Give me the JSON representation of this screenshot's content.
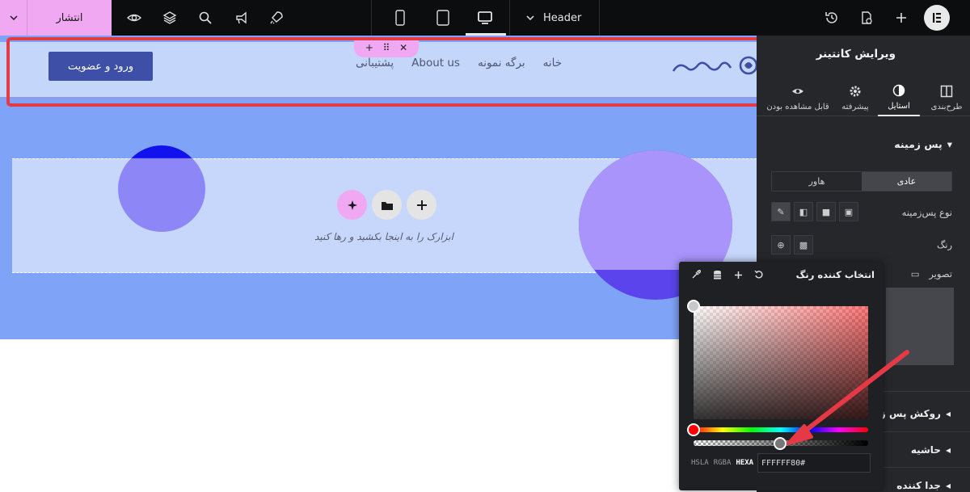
{
  "topbar": {
    "publish_label": "انتشار",
    "document_name": "Header",
    "icons": [
      "chevron-down-icon",
      "eye-icon",
      "layers-icon",
      "search-icon",
      "megaphone-icon",
      "rocket-icon",
      "mobile-icon",
      "tablet-icon",
      "desktop-icon",
      "history-icon",
      "page-settings-icon",
      "plus-icon",
      "elementor-logo"
    ]
  },
  "canvas": {
    "header": {
      "login_button": "ورود و عضویت",
      "nav": [
        "خانه",
        "برگه نمونه",
        "About us",
        "پشتیبانی"
      ],
      "logo_alt": "میهن وردپرس"
    },
    "drop_zone_text": "ابزارک را به اینجا بکشید و رها کنید",
    "colors": {
      "hero_bg": "#7fa3f7",
      "header_bg": "#c5d6fb",
      "button_bg": "#3e4fa8",
      "highlight": "#e63946",
      "accent_pink": "#f0a8f2"
    }
  },
  "panel": {
    "title": "ویرایش کانتینر",
    "tabs": [
      {
        "label": "طرح‌بندی",
        "icon": "layout-icon"
      },
      {
        "label": "استایل",
        "icon": "contrast-icon",
        "active": true
      },
      {
        "label": "پیشرفته",
        "icon": "gear-icon"
      },
      {
        "label": "قابل مشاهده بودن",
        "icon": "eye-icon"
      }
    ],
    "section_background": "پس زمینه",
    "state_normal": "عادی",
    "state_hover": "هاور",
    "bg_type_label": "نوع پس‌زمینه",
    "color_label": "رنگ",
    "image_label": "تصویر",
    "accordion": [
      "روکش پس زمی",
      "حاشیه",
      "جدا کننده"
    ]
  },
  "color_picker": {
    "title": "انتخاب کننده رنگ",
    "formats": [
      "HSLA",
      "RGBA",
      "HEXA"
    ],
    "selected_format": "HEXA",
    "hex_value": "FFFFFF80#"
  }
}
